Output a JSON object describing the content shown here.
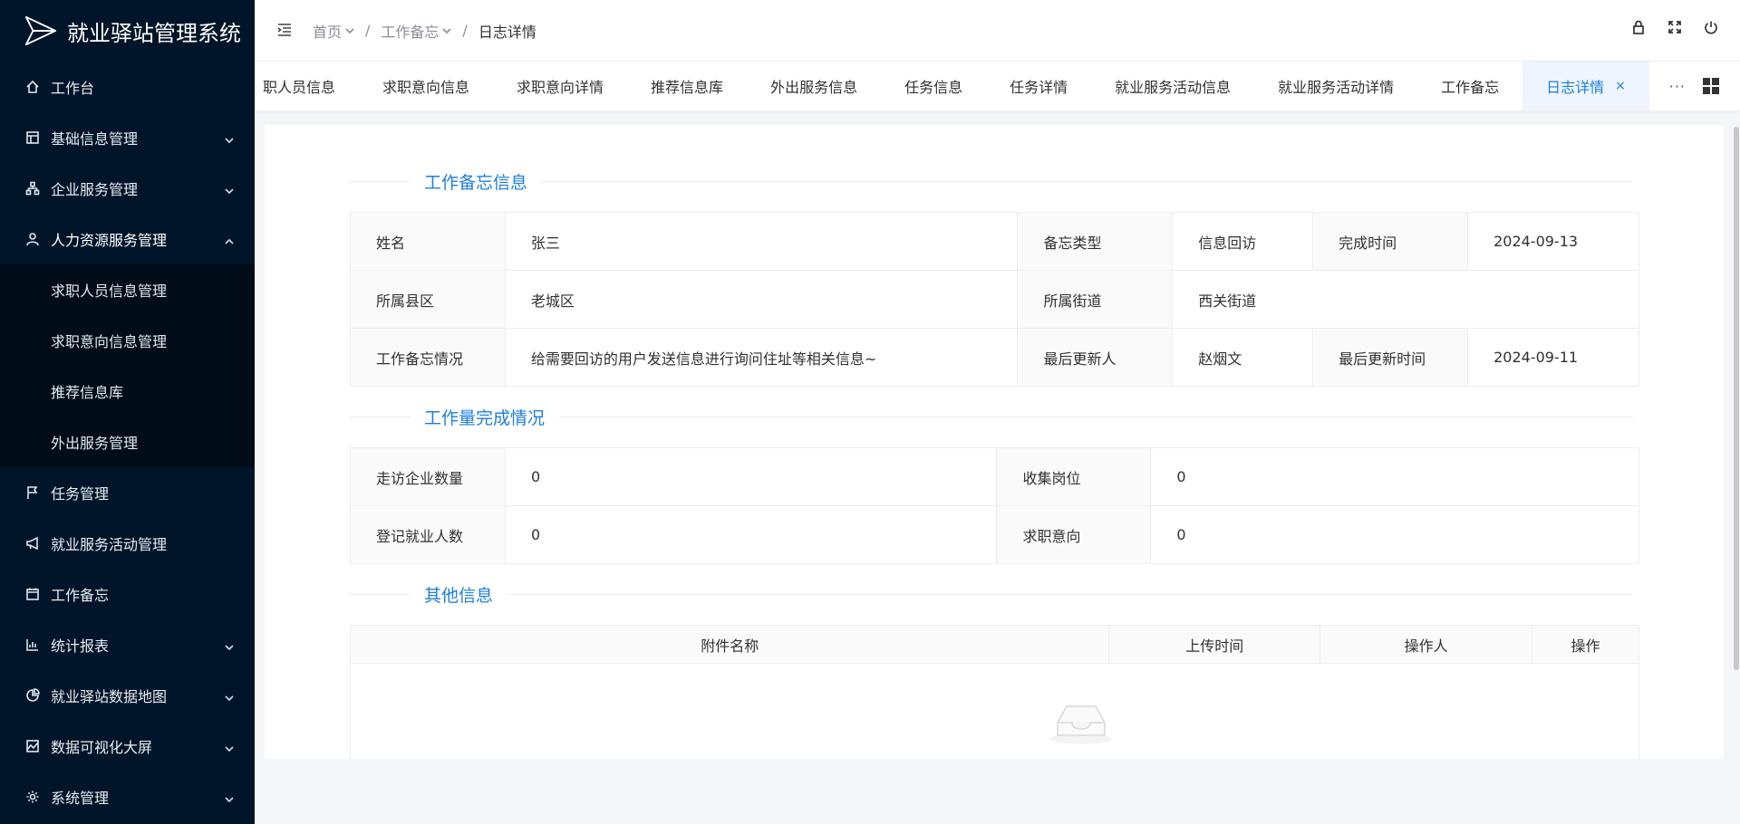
{
  "app": {
    "title": "就业驿站管理系统"
  },
  "sidebar": {
    "items": [
      {
        "label": "工作台",
        "icon": "home-icon"
      },
      {
        "label": "基础信息管理",
        "icon": "layout-icon"
      },
      {
        "label": "企业服务管理",
        "icon": "cluster-icon"
      },
      {
        "label": "人力资源服务管理",
        "icon": "user-icon"
      },
      {
        "label": "任务管理",
        "icon": "flag-icon"
      },
      {
        "label": "就业服务活动管理",
        "icon": "megaphone-icon"
      },
      {
        "label": "工作备忘",
        "icon": "calendar-icon"
      },
      {
        "label": "统计报表",
        "icon": "bar-chart-icon"
      },
      {
        "label": "就业驿站数据地图",
        "icon": "pie-chart-icon"
      },
      {
        "label": "数据可视化大屏",
        "icon": "area-chart-icon"
      },
      {
        "label": "系统管理",
        "icon": "gear-icon"
      }
    ],
    "submenu": [
      "求职人员信息管理",
      "求职意向信息管理",
      "推荐信息库",
      "外出服务管理"
    ]
  },
  "header": {
    "breadcrumb": [
      "首页",
      "工作备忘",
      "日志详情"
    ]
  },
  "tabs": {
    "items": [
      "职人员信息",
      "求职意向信息",
      "求职意向详情",
      "推荐信息库",
      "外出服务信息",
      "任务信息",
      "任务详情",
      "就业服务活动信息",
      "就业服务活动详情",
      "工作备忘",
      "日志详情"
    ],
    "close": "×",
    "more": "···"
  },
  "memo": {
    "title": "工作备忘信息",
    "rows": [
      [
        {
          "label": "姓名",
          "value": "张三"
        },
        {
          "label": "备忘类型",
          "value": "信息回访"
        },
        {
          "label": "完成时间",
          "value": "2024-09-13"
        }
      ],
      [
        {
          "label": "所属县区",
          "value": "老城区"
        },
        {
          "label": "所属街道",
          "value": "西关街道"
        }
      ],
      [
        {
          "label": "工作备忘情况",
          "value": "给需要回访的用户发送信息进行询问住址等相关信息~"
        },
        {
          "label": "最后更新人",
          "value": "赵烟文"
        },
        {
          "label": "最后更新时间",
          "value": "2024-09-11"
        }
      ]
    ]
  },
  "workload": {
    "title": "工作量完成情况",
    "rows": [
      [
        {
          "label": "走访企业数量",
          "value": "0"
        },
        {
          "label": "收集岗位",
          "value": "0"
        }
      ],
      [
        {
          "label": "登记就业人数",
          "value": "0"
        },
        {
          "label": "求职意向",
          "value": "0"
        }
      ]
    ]
  },
  "other": {
    "title": "其他信息",
    "columns": [
      "附件名称",
      "上传时间",
      "操作人",
      "操作"
    ]
  },
  "colors": {
    "sidebar_bg": "#001529",
    "submenu_bg": "#000c17",
    "accent": "#1a7fe0"
  }
}
